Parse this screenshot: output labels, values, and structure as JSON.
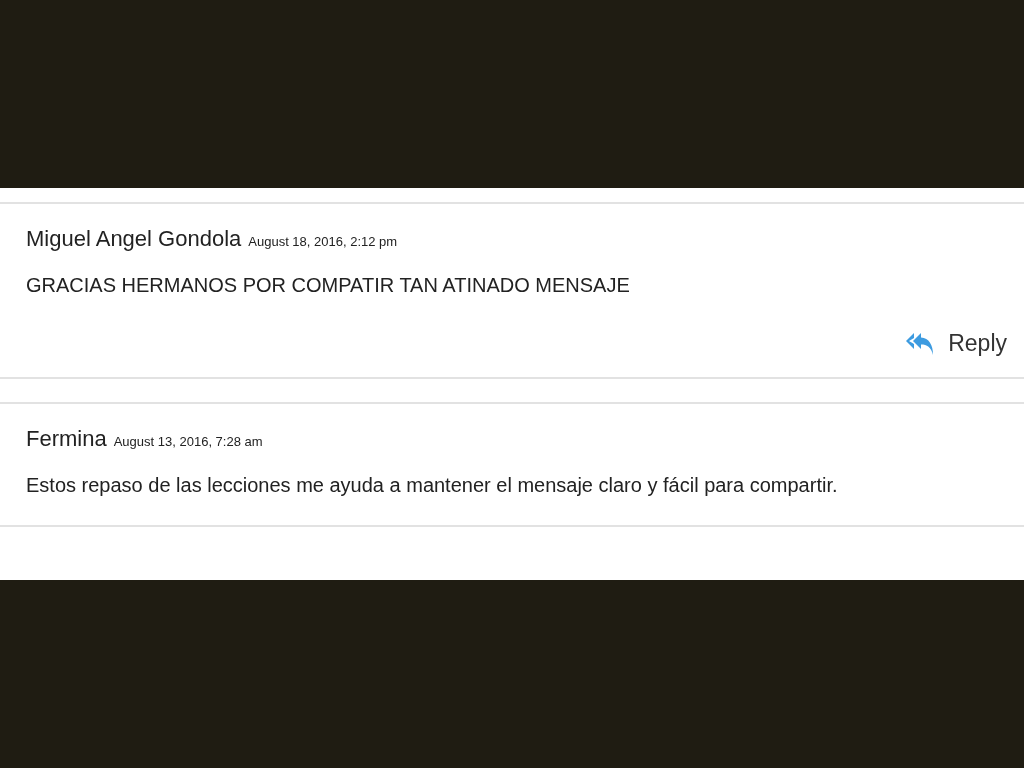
{
  "comments": [
    {
      "author": "Miguel Angel Gondola",
      "date": "August 18, 2016, 2:12 pm",
      "text": "GRACIAS HERMANOS POR COMPATIR TAN ATINADO MENSAJE",
      "reply": "Reply"
    },
    {
      "author": "Fermina",
      "date": "August 13, 2016, 7:28 am",
      "text": "Estos repaso de las lecciones me ayuda a mantener el mensaje claro y fácil para compartir."
    }
  ]
}
